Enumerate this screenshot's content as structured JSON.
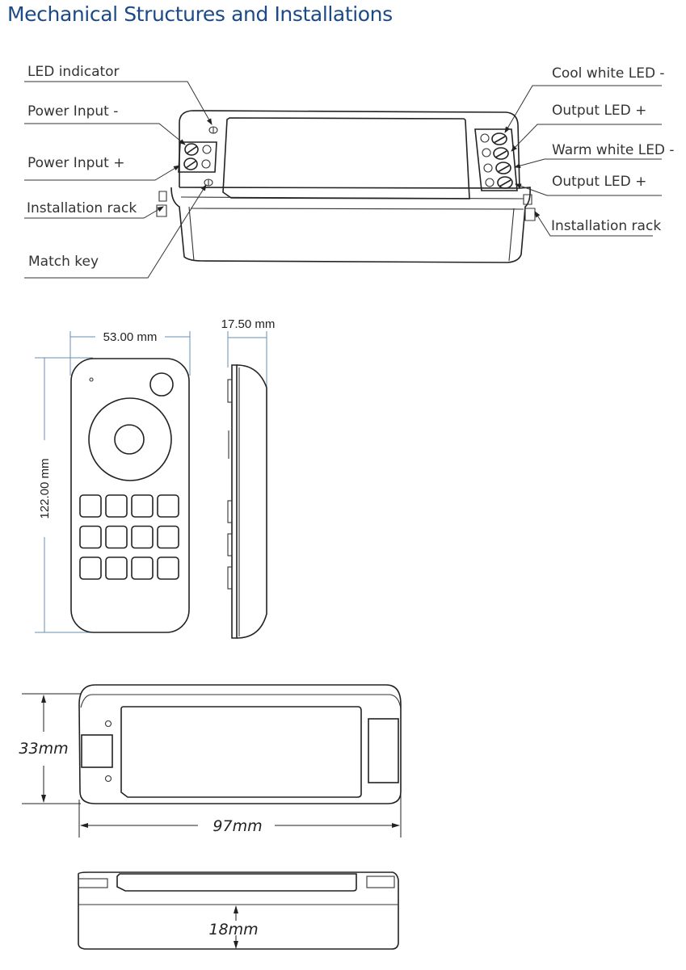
{
  "page": {
    "title": "Mechanical Structures and Installations"
  },
  "controller_perspective": {
    "left_callouts": [
      {
        "label": "LED indicator"
      },
      {
        "label": "Power Input -"
      },
      {
        "label": "Power Input +"
      },
      {
        "label": "Installation rack"
      },
      {
        "label": "Match key"
      }
    ],
    "right_callouts": [
      {
        "label": "Cool white LED -"
      },
      {
        "label": "Output LED +"
      },
      {
        "label": "Warm white LED -"
      },
      {
        "label": "Output LED +"
      },
      {
        "label": "Installation rack"
      }
    ]
  },
  "remote": {
    "width_label": "53.00 mm",
    "height_label": "122.00 mm",
    "depth_label": "17.50 mm",
    "button_rows": 3,
    "button_cols": 4
  },
  "controller_top": {
    "height_label": "33mm",
    "width_label": "97mm"
  },
  "controller_side": {
    "thickness_label": "18mm"
  }
}
